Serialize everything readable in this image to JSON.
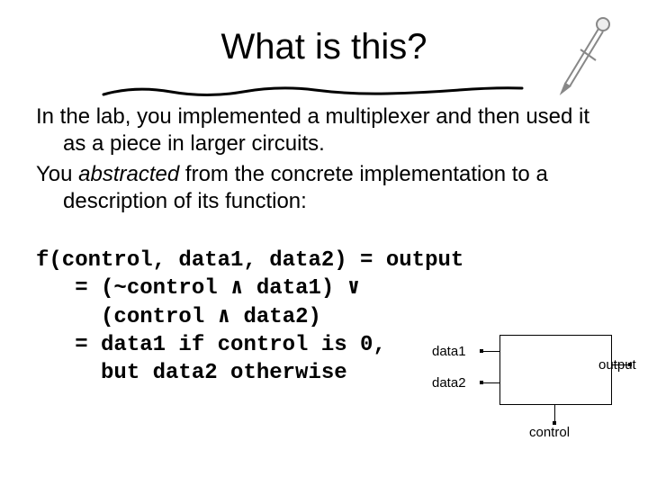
{
  "title": "What is this?",
  "para1_a": "In the lab, you implemented a multiplexer and then used it as a piece in larger circuits.",
  "para2_a": "You ",
  "para2_b": "abstracted",
  "para2_c": " from the concrete implementation to a description of its function:",
  "code": {
    "l1": "f(control, data1, data2) = output",
    "l2": "   = (~control ∧ data1) ∨",
    "l3": "     (control ∧ data2)",
    "l4": "   = data1 if control is 0,",
    "l5": "     but data2 otherwise"
  },
  "diagram": {
    "data1": "data1",
    "data2": "data2",
    "control": "control",
    "output": "output"
  }
}
